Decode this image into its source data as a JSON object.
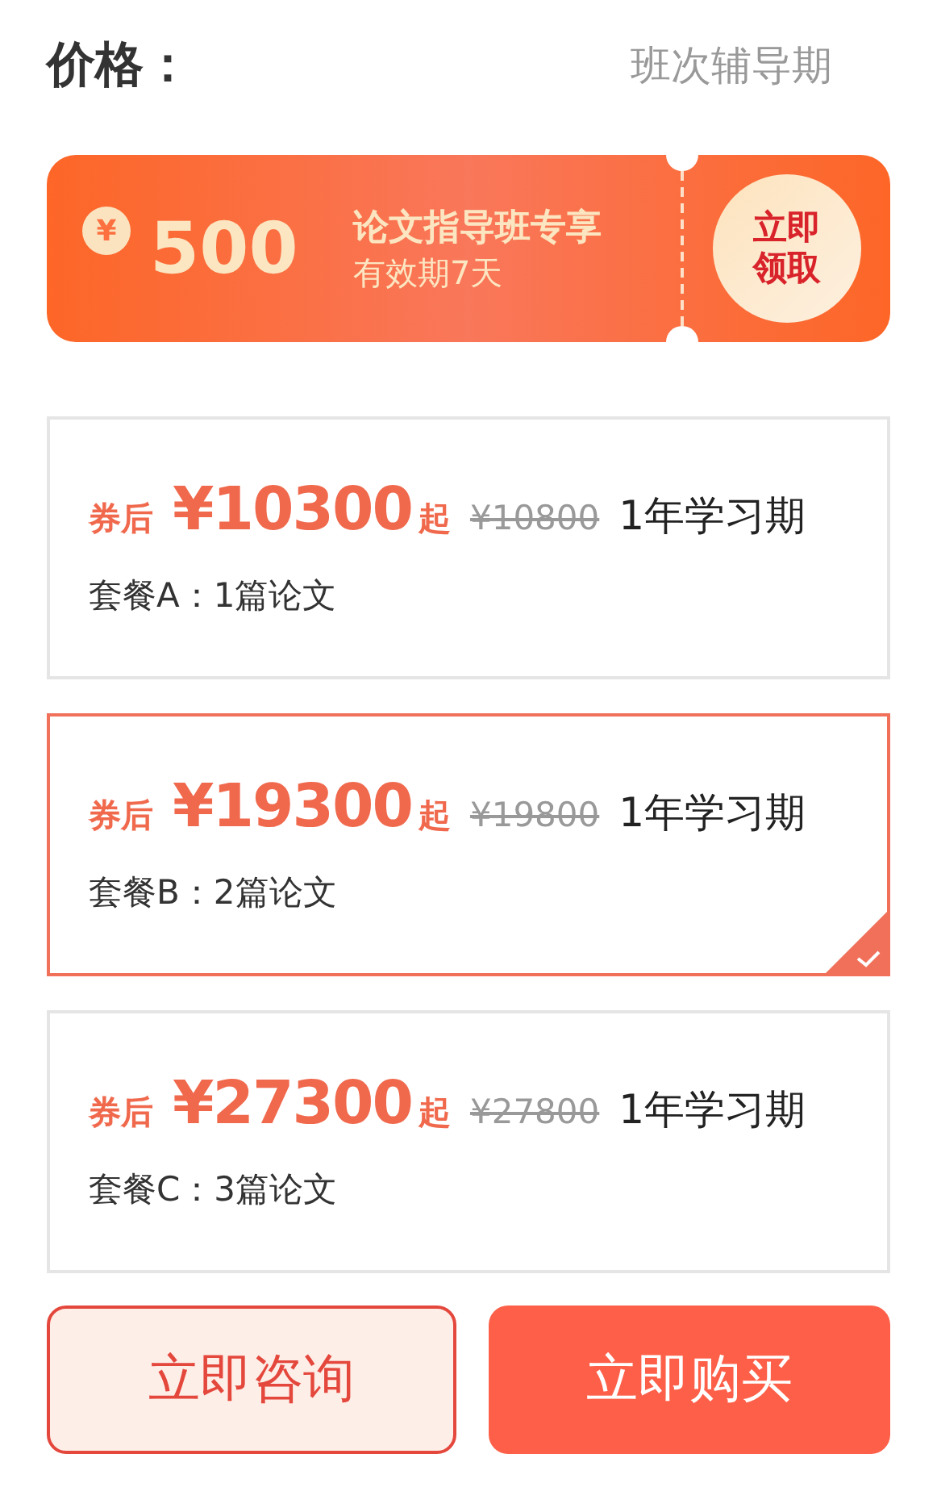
{
  "header": {
    "title": "价格：",
    "subtitle": "班次辅导期"
  },
  "coupon": {
    "symbol": "¥",
    "amount": "500",
    "title": "论文指导班专享",
    "validity": "有效期7天",
    "claim": "立即领取"
  },
  "packages": [
    {
      "prefix": "券后",
      "price": "¥10300",
      "suffix": "起",
      "original": "¥10800",
      "period": "1年学习期",
      "name": "套餐A：1篇论文",
      "selected": false
    },
    {
      "prefix": "券后",
      "price": "¥19300",
      "suffix": "起",
      "original": "¥19800",
      "period": "1年学习期",
      "name": "套餐B：2篇论文",
      "selected": true
    },
    {
      "prefix": "券后",
      "price": "¥27300",
      "suffix": "起",
      "original": "¥27800",
      "period": "1年学习期",
      "name": "套餐C：3篇论文",
      "selected": false
    }
  ],
  "buttons": [
    {
      "label": "立即咨询",
      "kind": "outline"
    },
    {
      "label": "立即购买",
      "kind": "solid"
    }
  ]
}
